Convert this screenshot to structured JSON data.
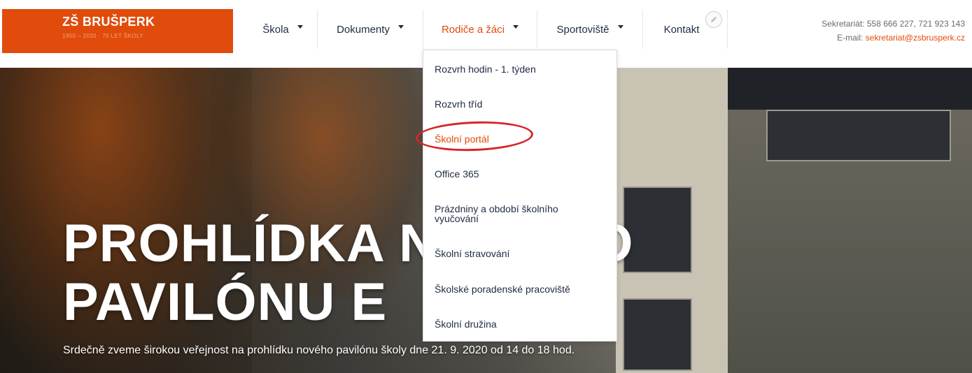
{
  "logo": {
    "title": "ZŠ BRUŠPERK",
    "subtitle": "1950 – 2020 · 70 LET ŠKOLY"
  },
  "nav": {
    "items": [
      {
        "label": "Škola",
        "has_dropdown": true
      },
      {
        "label": "Dokumenty",
        "has_dropdown": true
      },
      {
        "label": "Rodiče a žáci",
        "has_dropdown": true,
        "active": true
      },
      {
        "label": "Sportoviště",
        "has_dropdown": true
      },
      {
        "label": "Kontakt",
        "has_dropdown": false
      }
    ],
    "edit_icon": "pencil-icon"
  },
  "contact": {
    "phone_line": "Sekretariát: 558 666 227, 721 923 143",
    "email_prefix": "E-mail: ",
    "email": "sekretariat@zsbrusperk.cz"
  },
  "dropdown": {
    "items": [
      "Rozvrh hodin - 1. týden",
      "Rozvrh tříd",
      "Školní portál",
      "Office 365",
      "Prázdniny a období školního vyučování",
      "Školní stravování",
      "Školské poradenské pracoviště",
      "Školní družina"
    ],
    "highlighted_index": 2
  },
  "hero": {
    "title_line1": "PROHLÍDKA NOVÉHO",
    "title_line2": "PAVILÓNU E",
    "text": "Srdečně zveme širokou veřejnost na prohlídku nového pavilónu školy dne 21. 9. 2020 od 14 do 18 hod."
  },
  "colors": {
    "brand": "#e14b0b",
    "nav_text": "#1f2a44",
    "annotation_ring": "#d6242a"
  }
}
